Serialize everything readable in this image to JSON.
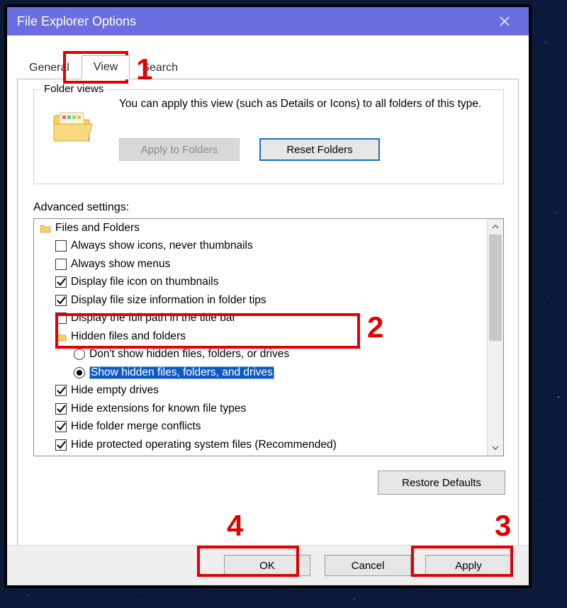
{
  "window": {
    "title": "File Explorer Options"
  },
  "tabs": {
    "general": "General",
    "view": "View",
    "search": "Search"
  },
  "folder_views": {
    "legend": "Folder views",
    "desc": "You can apply this view (such as Details or Icons) to all folders of this type.",
    "apply": "Apply to Folders",
    "reset": "Reset Folders"
  },
  "advanced": {
    "label": "Advanced settings:",
    "root": "Files and Folders",
    "items": [
      "Always show icons, never thumbnails",
      "Always show menus",
      "Display file icon on thumbnails",
      "Display file size information in folder tips",
      "Display the full path in the title bar"
    ],
    "hidden_group": "Hidden files and folders",
    "hidden_opts": [
      "Don't show hidden files, folders, or drives",
      "Show hidden files, folders, and drives"
    ],
    "tail": [
      "Hide empty drives",
      "Hide extensions for known file types",
      "Hide folder merge conflicts",
      "Hide protected operating system files (Recommended)"
    ],
    "checks_head": [
      false,
      false,
      true,
      true,
      false
    ],
    "checks_tail": [
      true,
      true,
      true,
      true
    ],
    "restore": "Restore Defaults"
  },
  "buttons": {
    "ok": "OK",
    "cancel": "Cancel",
    "apply": "Apply"
  },
  "annotations": {
    "n1": "1",
    "n2": "2",
    "n3": "3",
    "n4": "4"
  }
}
